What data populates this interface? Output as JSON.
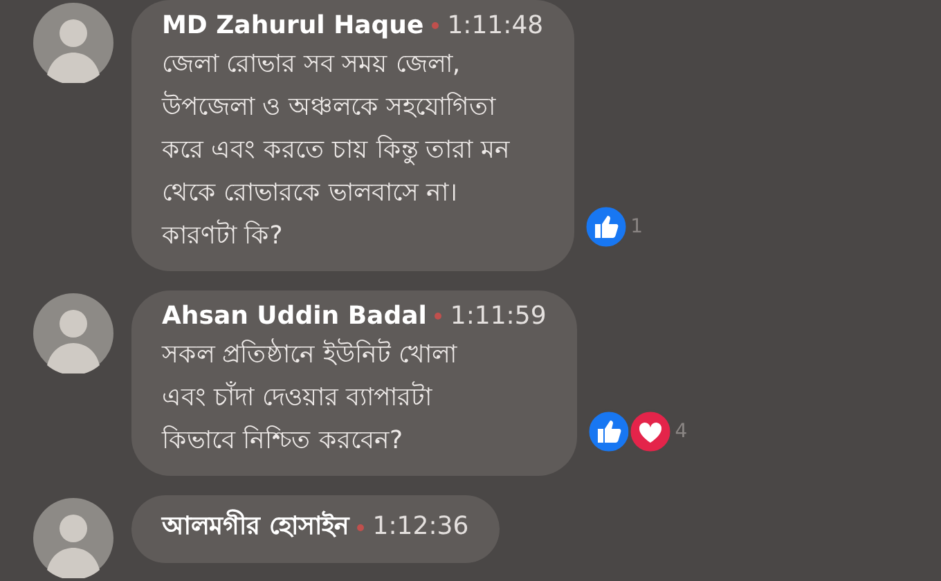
{
  "comments": [
    {
      "author": "MD Zahurul Haque",
      "time": "1:11:48",
      "text": "জেলা রোভার সব সময় জেলা,\nউপজেলা ও অঞ্চলকে সহযোগিতা\nকরে এবং করতে চায় কিন্তু তারা মন\nথেকে রোভারকে ভালবাসে না।\nকারণটা কি?",
      "reactions": [
        {
          "kind": "like"
        }
      ],
      "reaction_count": "1"
    },
    {
      "author": "Ahsan Uddin Badal",
      "time": "1:11:59",
      "text": "সকল প্রতিষ্ঠানে ইউনিট খোলা\nএবং চাঁদা দেওয়ার ব্যাপারটা\nকিভাবে  নিশ্চিত করবেন?",
      "reactions": [
        {
          "kind": "like"
        },
        {
          "kind": "love"
        }
      ],
      "reaction_count": "4"
    },
    {
      "author": "আলমগীর হোসাইন",
      "time": "1:12:36"
    }
  ]
}
